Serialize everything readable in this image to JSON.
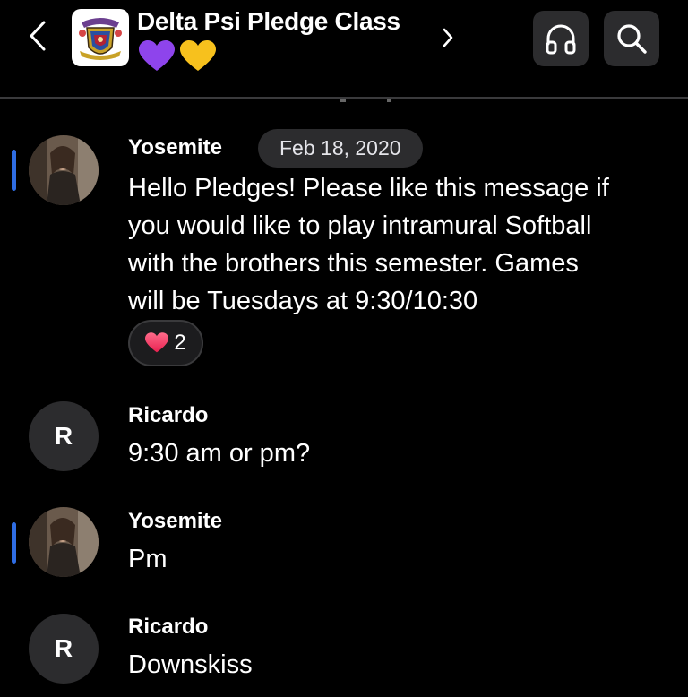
{
  "header": {
    "title": "Delta Psi Pledge Class",
    "emojis": [
      "purple-heart",
      "yellow-heart"
    ],
    "icons": {
      "back": "chevron-left-icon",
      "details": "chevron-right-icon",
      "voice": "headphones-icon",
      "search": "search-icon",
      "group": "crest-icon"
    }
  },
  "messages": [
    {
      "sender": "Yosemite",
      "date": "Feb 18, 2020",
      "text_lines": [
        "Hello Pledges! Please like this message if",
        "you would like to play intramural Softball",
        "with the brothers this semester. Games",
        "will be Tuesdays at 9:30/10:30"
      ],
      "reaction": {
        "icon": "heart-icon",
        "count": "2"
      }
    },
    {
      "sender": "Ricardo",
      "avatar_letter": "R",
      "text": "9:30 am or pm?"
    },
    {
      "sender": "Yosemite",
      "text": "Pm"
    },
    {
      "sender": "Ricardo",
      "avatar_letter": "R",
      "text": "Downskiss"
    }
  ],
  "colors": {
    "background": "#000000",
    "bubble": "#2c2c2e",
    "unread_indicator": "#2f6de3",
    "purple_heart": "#8e44ec",
    "yellow_heart": "#f7c11d",
    "reaction_heart": "#ff3d6b"
  }
}
